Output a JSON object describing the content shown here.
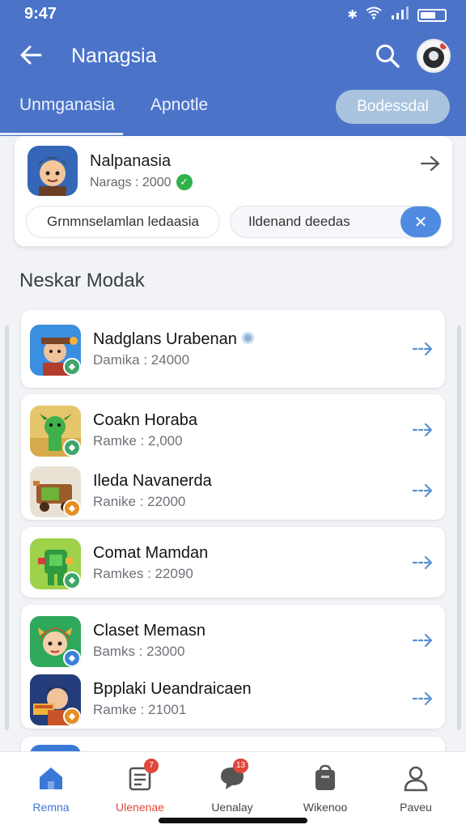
{
  "status_bar": {
    "time": "9:47",
    "icons": [
      "bluetooth-icon",
      "wifi-icon",
      "signal-icon",
      "battery-icon"
    ]
  },
  "header": {
    "title": "Nanagsia",
    "tabs": [
      {
        "label": "Unmganasia"
      },
      {
        "label": "Apnotle"
      }
    ],
    "chip_label": "Bodessdal"
  },
  "profile": {
    "name": "Nalpanasia",
    "subtitle": "Narags : 2000",
    "filter_left": "Grnmnselamlan ledaasia",
    "filter_right": "Ildenand deedas"
  },
  "section_title": "Neskar Modak",
  "list": [
    {
      "title": "Nadglans Urabenan",
      "meta": "Damika : 24000"
    },
    {
      "title": "Coakn Horaba",
      "meta": "Ramke : 2,000"
    },
    {
      "title": "Ileda Navanerda",
      "meta": "Ranike : 22000"
    },
    {
      "title": "Comat Mamdan",
      "meta": "Ramkes : 22090"
    },
    {
      "title": "Claset Memasn",
      "meta": "Bamks : 23000"
    },
    {
      "title": "Bpplaki Ueandraicaen",
      "meta": "Ramke : 21001"
    }
  ],
  "bottom_nav": [
    {
      "label": "Remna",
      "icon": "home-icon"
    },
    {
      "label": "Ulenenae",
      "icon": "document-icon",
      "badge": "7"
    },
    {
      "label": "Uenalay",
      "icon": "chat-icon",
      "badge": "13"
    },
    {
      "label": "Wikenoo",
      "icon": "bag-icon"
    },
    {
      "label": "Paveu",
      "icon": "profile-icon"
    }
  ],
  "colors": {
    "header": "#4b74c9",
    "accent": "#4f8be0",
    "active_nav": "#3a78d8",
    "selected_nav_label": "#e0483b",
    "badge": "#e0483b",
    "verified": "#2fb24a"
  }
}
